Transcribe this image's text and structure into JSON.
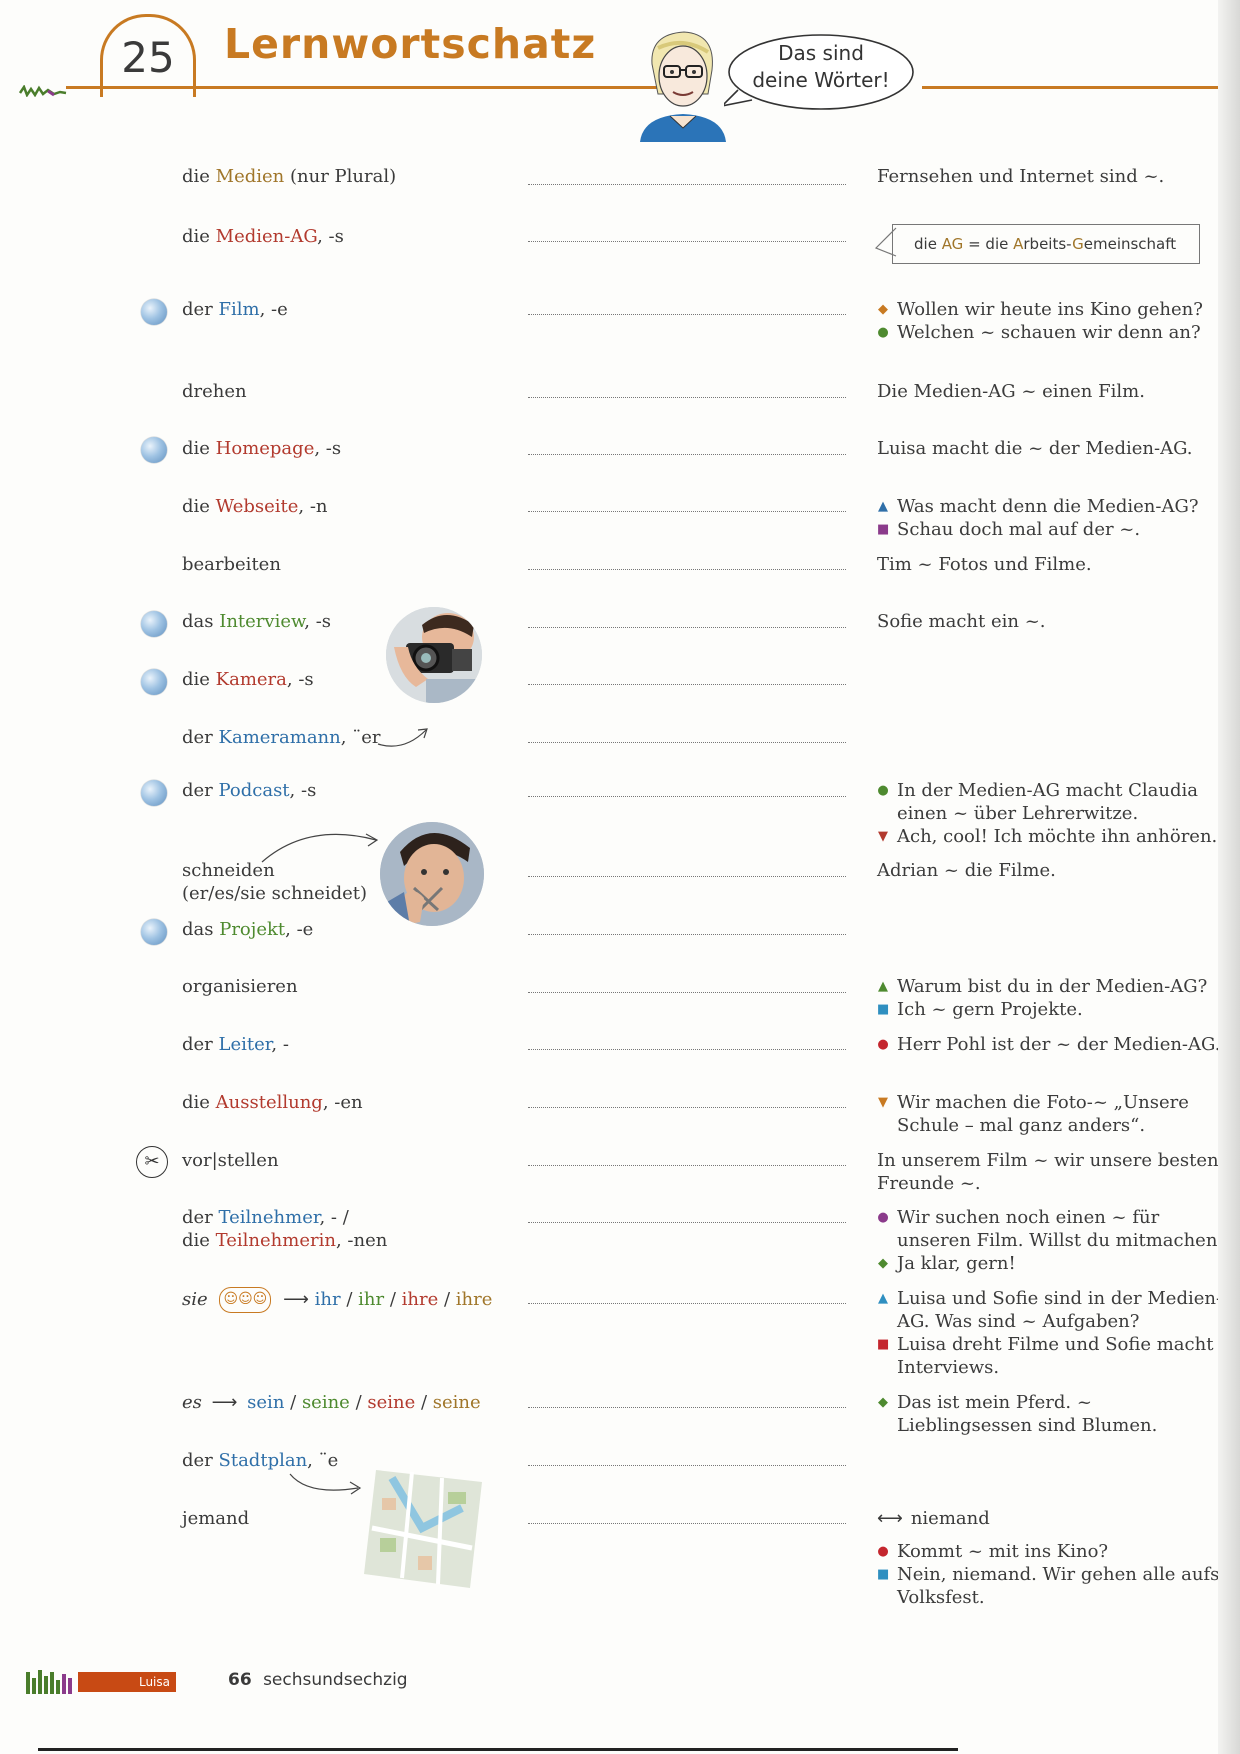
{
  "header": {
    "chapter_number": "25",
    "title": "Lernwortschatz",
    "speech_line1": "Das sind",
    "speech_line2": "deine Wörter!",
    "accent_color": "#c87a22"
  },
  "rows": [
    {
      "l1": "die ",
      "t": "Medien",
      "tc": "olive",
      "l2": " (nur Plural)",
      "globe": false,
      "r": [
        {
          "m": "",
          "t": "Fernsehen und Internet sind ~."
        }
      ]
    },
    {
      "l1": "die ",
      "t": "Medien-AG",
      "tc": "red",
      "l2": ", -s",
      "globe": false,
      "r": []
    },
    {
      "l1": "der ",
      "t": "Film",
      "tc": "blue",
      "l2": ", -e",
      "globe": true,
      "r": [
        {
          "m": "diamond-orange",
          "t": "Wollen wir heute ins Kino gehen?"
        },
        {
          "m": "dot-green",
          "t": "Welchen ~ schauen wir denn an?"
        }
      ]
    },
    {
      "l1": "drehen",
      "t": "",
      "tc": "",
      "l2": "",
      "globe": false,
      "r": [
        {
          "m": "",
          "t": "Die Medien-AG ~ einen Film."
        }
      ]
    },
    {
      "l1": "die ",
      "t": "Homepage",
      "tc": "red",
      "l2": ", -s",
      "globe": true,
      "r": [
        {
          "m": "",
          "t": "Luisa macht die ~ der Medien-AG."
        }
      ]
    },
    {
      "l1": "die ",
      "t": "Webseite",
      "tc": "red",
      "l2": ", -n",
      "globe": false,
      "r": [
        {
          "m": "triangle-blue",
          "t": "Was macht denn die Medien-AG?"
        },
        {
          "m": "square-purple",
          "t": "Schau doch mal auf der ~."
        }
      ]
    },
    {
      "l1": "bearbeiten",
      "t": "",
      "tc": "",
      "l2": "",
      "globe": false,
      "r": [
        {
          "m": "",
          "t": "Tim ~ Fotos und Filme."
        }
      ]
    },
    {
      "l1": "das ",
      "t": "Interview",
      "tc": "green",
      "l2": ", -s",
      "globe": true,
      "r": [
        {
          "m": "",
          "t": "Sofie macht ein ~."
        }
      ]
    },
    {
      "l1": "die ",
      "t": "Kamera",
      "tc": "red",
      "l2": ", -s",
      "globe": true,
      "r": []
    },
    {
      "l1": "der ",
      "t": "Kameramann",
      "tc": "blue",
      "l2": ", ¨er",
      "globe": false,
      "r": []
    },
    {
      "l1": "der ",
      "t": "Podcast",
      "tc": "blue",
      "l2": ", -s",
      "globe": true,
      "r": [
        {
          "m": "dot-green",
          "t": "In der Medien-AG macht Claudia einen ~ über Lehrerwitze."
        },
        {
          "m": "triangle-down-red",
          "t": "Ach, cool! Ich möchte ihn anhören."
        }
      ]
    },
    {
      "l1": "schneiden",
      "t": "",
      "tc": "",
      "l2": "",
      "l3": "(er/es/sie schneidet)",
      "globe": false,
      "r": [
        {
          "m": "",
          "t": "Adrian ~ die Filme."
        }
      ]
    },
    {
      "l1": "das ",
      "t": "Projekt",
      "tc": "green",
      "l2": ", -e",
      "globe": true,
      "r": []
    },
    {
      "l1": "organisieren",
      "t": "",
      "tc": "",
      "l2": "",
      "globe": false,
      "r": [
        {
          "m": "triangle-green",
          "t": "Warum bist du in der Medien-AG?"
        },
        {
          "m": "square-blue",
          "t": "Ich ~ gern Projekte."
        }
      ]
    },
    {
      "l1": "der ",
      "t": "Leiter",
      "tc": "blue",
      "l2": ", -",
      "globe": false,
      "r": [
        {
          "m": "dot-red",
          "t": "Herr Pohl ist der ~ der Medien-AG."
        }
      ]
    },
    {
      "l1": "die ",
      "t": "Ausstellung",
      "tc": "red",
      "l2": ", -en",
      "globe": false,
      "r": [
        {
          "m": "triangle-down-orange",
          "t": "Wir machen die Foto-~ „Unsere Schule – mal ganz anders“."
        }
      ]
    },
    {
      "l1": "vor|stellen",
      "t": "",
      "tc": "",
      "l2": "",
      "globe": false,
      "scissors": true,
      "r": [
        {
          "m": "",
          "t": "In unserem Film ~ wir unsere besten Freunde ~."
        }
      ]
    },
    {
      "l1": "der ",
      "t": "Teilnehmer",
      "tc": "blue",
      "l2": ", - /",
      "l3a": "die ",
      "l3t": "Teilnehmerin",
      "l3b": ", -nen",
      "globe": false,
      "r": [
        {
          "m": "dot-purple",
          "t": "Wir suchen noch einen ~ für unseren Film. Willst du mitmachen?"
        },
        {
          "m": "diamond-green",
          "t": "Ja klar, gern!"
        }
      ]
    },
    {
      "l1": "",
      "t": "",
      "tc": "",
      "l2": "",
      "globe": false,
      "sie": true,
      "r": [
        {
          "m": "triangle-blue",
          "t": "Luisa und Sofie sind in der Medien-AG. Was sind ~ Aufgaben?"
        },
        {
          "m": "square-red",
          "t": "Luisa dreht Filme und Sofie macht Interviews."
        }
      ]
    },
    {
      "l1": "",
      "t": "",
      "tc": "",
      "l2": "",
      "globe": false,
      "es": true,
      "r": [
        {
          "m": "diamond-green",
          "t": "Das ist mein Pferd. ~ Lieblingsessen sind Blumen."
        }
      ]
    },
    {
      "l1": "der ",
      "t": "Stadtplan",
      "tc": "blue",
      "l2": ", ¨e",
      "globe": false,
      "r": []
    },
    {
      "l1": "jemand",
      "t": "",
      "tc": "",
      "l2": "",
      "globe": false,
      "r": [
        {
          "m": "arrow-both",
          "t": "niemand"
        },
        {
          "m": "dot-red",
          "t": "Kommt ~ mit ins Kino?"
        },
        {
          "m": "square-blue",
          "t": "Nein, niemand. Wir gehen alle aufs Volksfest."
        }
      ]
    }
  ],
  "ag_box": {
    "pre": "die ",
    "ag": "AG",
    "mid": " = die ",
    "a": "A",
    "rbeits": "rbeits-",
    "g": "G",
    "emeinschaft": "emeinschaft"
  },
  "possessive": {
    "sie_label": "sie",
    "sie_forms": [
      "ihr",
      "ihr",
      "ihre",
      "ihre"
    ],
    "es_label": "es",
    "es_forms": [
      "sein",
      "seine",
      "seine",
      "seine"
    ],
    "sep": " / "
  },
  "footer": {
    "name_tag": "Luisa",
    "page_number": "66",
    "page_word": "sechsundsechzig"
  }
}
